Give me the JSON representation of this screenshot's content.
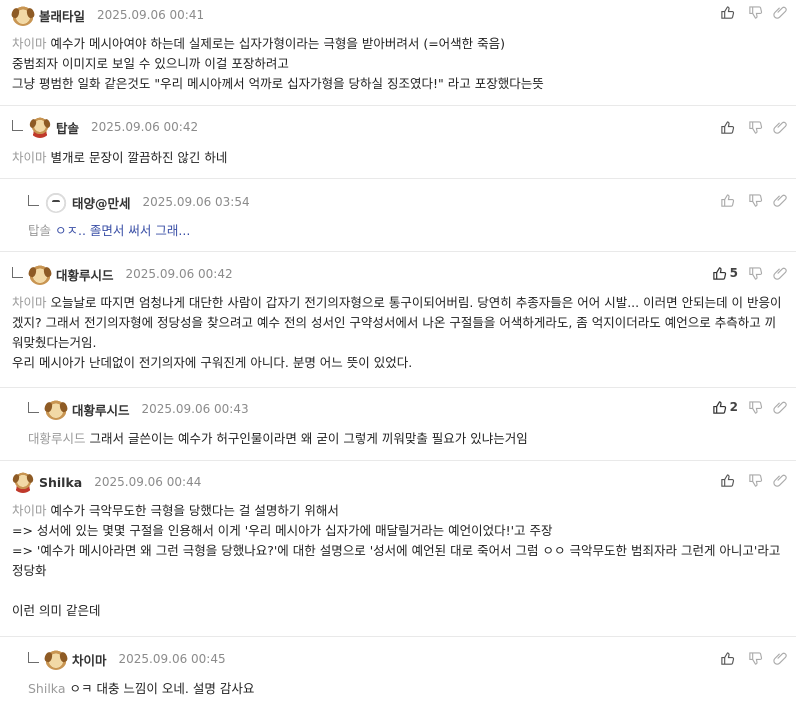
{
  "comments": [
    {
      "author": "볼래타일",
      "date": "2025.09.06 00:41",
      "avatar": "dog",
      "reply": false,
      "mention": "차이마",
      "body": "예수가 메시아여야 하는데 실제로는 십자가형이라는 극형을 받아버려서 (=어색한 죽음)\n중범죄자 이미지로 보일 수 있으니까 이걸 포장하려고\n그냥 평범한 일화 같은것도 \"우리 메시아께서 억까로 십자가형을 당하실 징조였다!\" 라고 포장했다는뜻",
      "likes": ""
    },
    {
      "author": "탑솔",
      "date": "2025.09.06 00:42",
      "avatar": "dog-red",
      "reply": false,
      "mention": "차이마",
      "body": "별개로 문장이 깔끔하진 않긴 하네",
      "likes": ""
    },
    {
      "author": "태양@만세",
      "date": "2025.09.06 03:54",
      "avatar": "white",
      "reply": true,
      "mention": "탑솔",
      "body": "ㅇㅈ.. 졸면서 써서 그래...",
      "likes": ""
    },
    {
      "author": "대황루시드",
      "date": "2025.09.06 00:42",
      "avatar": "dog",
      "reply": false,
      "mention": "차이마",
      "body": "오늘날로 따지면 엄청나게 대단한 사람이 갑자기 전기의자형으로 통구이되어버림. 당연히 추종자들은 어어 시발... 이러면 안되는데 이 반응이겠지? 그래서 전기의자형에 정당성을 찾으려고 예수 전의 성서인 구약성서에서 나온 구절들을 어색하게라도, 좀 억지이더라도 예언으로 추측하고 끼워맞췄다는거임.\n우리 메시아가 난데없이 전기의자에 구워진게 아니다. 분명 어느 뜻이 있었다.",
      "likes": "5"
    },
    {
      "author": "대황루시드",
      "date": "2025.09.06 00:43",
      "avatar": "dog",
      "reply": true,
      "mention": "대황루시드",
      "body": "그래서 글쓴이는 예수가 허구인물이라면 왜 굳이 그렇게 끼워맞출 필요가 있냐는거임",
      "likes": "2"
    },
    {
      "author": "Shilka",
      "date": "2025.09.06 00:44",
      "avatar": "dog-red",
      "reply": false,
      "mention": "차이마",
      "body": "예수가 극악무도한 극형을 당했다는 걸 설명하기 위해서\n=> 성서에 있는 몇몇 구절을 인용해서 이게 '우리 메시아가 십자가에 매달릴거라는 예언이었다!'고 주장\n=> '예수가 메시아라면 왜 그런 극형을 당했나요?'에 대한 설명으로 '성서에 예언된 대로 죽어서 그럼 ㅇㅇ 극악무도한 범죄자라 그런게 아니고'라고 정당화\n\n이런 의미 같은데",
      "likes": ""
    },
    {
      "author": "차이마",
      "date": "2025.09.06 00:45",
      "avatar": "dog",
      "reply": true,
      "mention": "Shilka",
      "body": "ㅇㅋ 대충 느낌이 오네. 설명 감사요",
      "likes": ""
    }
  ]
}
